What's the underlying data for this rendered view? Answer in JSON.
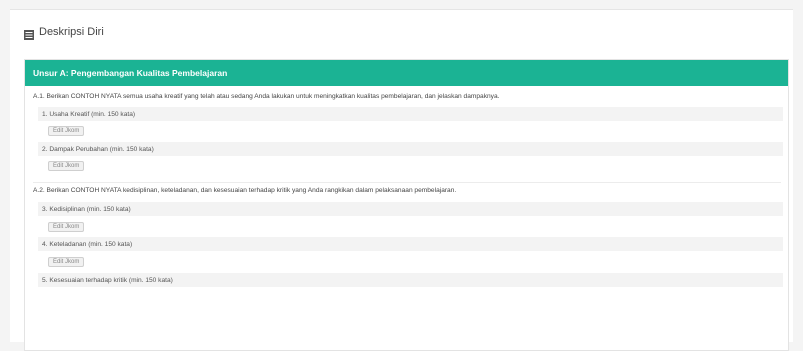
{
  "header": {
    "title": "Deskripsi Diri",
    "icon": "list-icon"
  },
  "section": {
    "title": "Unsur A: Pengembangan Kualitas Pembelajaran",
    "accent_color": "#1bb394",
    "questions": [
      {
        "text": "A.1. Berikan CONTOH NYATA semua usaha kreatif yang telah atau sedang Anda lakukan untuk meningkatkan kualitas pembelajaran, dan jelaskan dampaknya.",
        "items": [
          {
            "label": "1. Usaha Kreatif (min. 150 kata)",
            "button": "Edit Jkom"
          },
          {
            "label": "2. Dampak Perubahan (min. 150 kata)",
            "button": "Edit Jkom"
          }
        ]
      },
      {
        "text": "A.2. Berikan CONTOH NYATA kedisiplinan, keteladanan, dan kesesuaian terhadap kritik yang Anda rangkikan dalam pelaksanaan pembelajaran.",
        "items": [
          {
            "label": "3. Kedisiplinan (min. 150 kata)",
            "button": "Edit Jkom"
          },
          {
            "label": "4. Keteladanan (min. 150 kata)",
            "button": "Edit Jkom"
          },
          {
            "label": "5. Kesesuaian terhadap kritik (min. 150 kata)",
            "button": ""
          }
        ]
      }
    ]
  }
}
